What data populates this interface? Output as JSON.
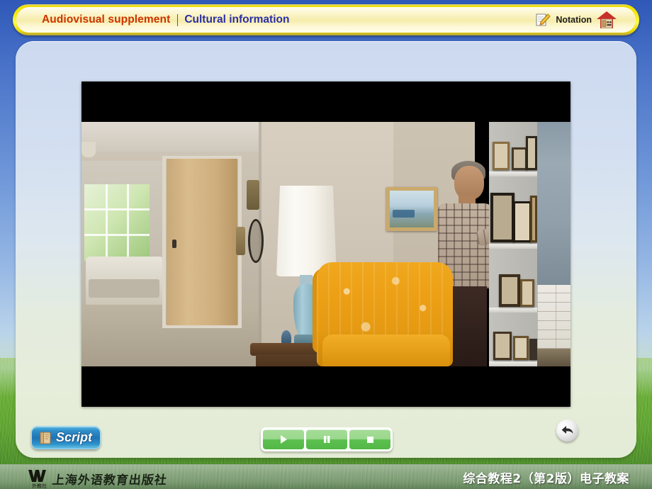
{
  "header": {
    "title_main": "Audiovisual supplement",
    "title_sub": "Cultural information",
    "notation_label": "Notation",
    "notation_icon": "note-pencil-icon",
    "home_icon": "house-icon",
    "divider": "title-divider"
  },
  "main": {
    "media": {
      "type": "video",
      "state": "paused",
      "letterbox": true,
      "scene_description": "Living room interior: a man in a short-sleeved plaid shirt reaches toward framed photographs on a white built-in bookshelf; an orange damask wing armchair, a blue ceramic table lamp with white shade on a dark wood side table, a doorway to a sunlit back room, a framed landscape painting, a blue-grey cabinet door and a white brick fireplace with brass-trimmed screen."
    }
  },
  "controls": {
    "script_label": "Script",
    "script_icon": "book-icon",
    "play_icon": "play-icon",
    "pause_icon": "pause-icon",
    "stop_icon": "stop-icon",
    "back_icon": "back-arrow-icon"
  },
  "footer": {
    "publisher_mark": "W",
    "publisher_sub": "外教社",
    "publisher_name": "上海外语教育出版社",
    "course_title": "综合教程2（第2版）电子教案"
  },
  "colors": {
    "title_main": "#cc3300",
    "title_sub": "#2a2ea8",
    "bar_yellow": "#f5ec12",
    "script_blue": "#1f74b4",
    "media_green": "#52b846",
    "footer_green": "#7b9b72"
  }
}
